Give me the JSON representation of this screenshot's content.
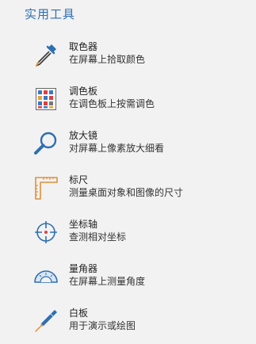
{
  "panel": {
    "title": "实用工具"
  },
  "tools": [
    {
      "name": "取色器",
      "desc": "在屏幕上拾取颜色",
      "icon": "eyedropper-icon"
    },
    {
      "name": "调色板",
      "desc": "在调色板上按需调色",
      "icon": "palette-grid-icon"
    },
    {
      "name": "放大镜",
      "desc": "对屏幕上像素放大细看",
      "icon": "magnifier-icon"
    },
    {
      "name": "标尺",
      "desc": "测量桌面对象和图像的尺寸",
      "icon": "ruler-icon"
    },
    {
      "name": "坐标轴",
      "desc": "查测相对坐标",
      "icon": "crosshair-icon"
    },
    {
      "name": "量角器",
      "desc": "在屏幕上测量角度",
      "icon": "protractor-icon"
    },
    {
      "name": "白板",
      "desc": "用于演示或绘图",
      "icon": "pen-icon"
    }
  ],
  "colors": {
    "accent": "#2f6fb3",
    "icon_blue": "#2e6fb0",
    "icon_orange": "#e0903a",
    "background": "#f2f2f2"
  }
}
